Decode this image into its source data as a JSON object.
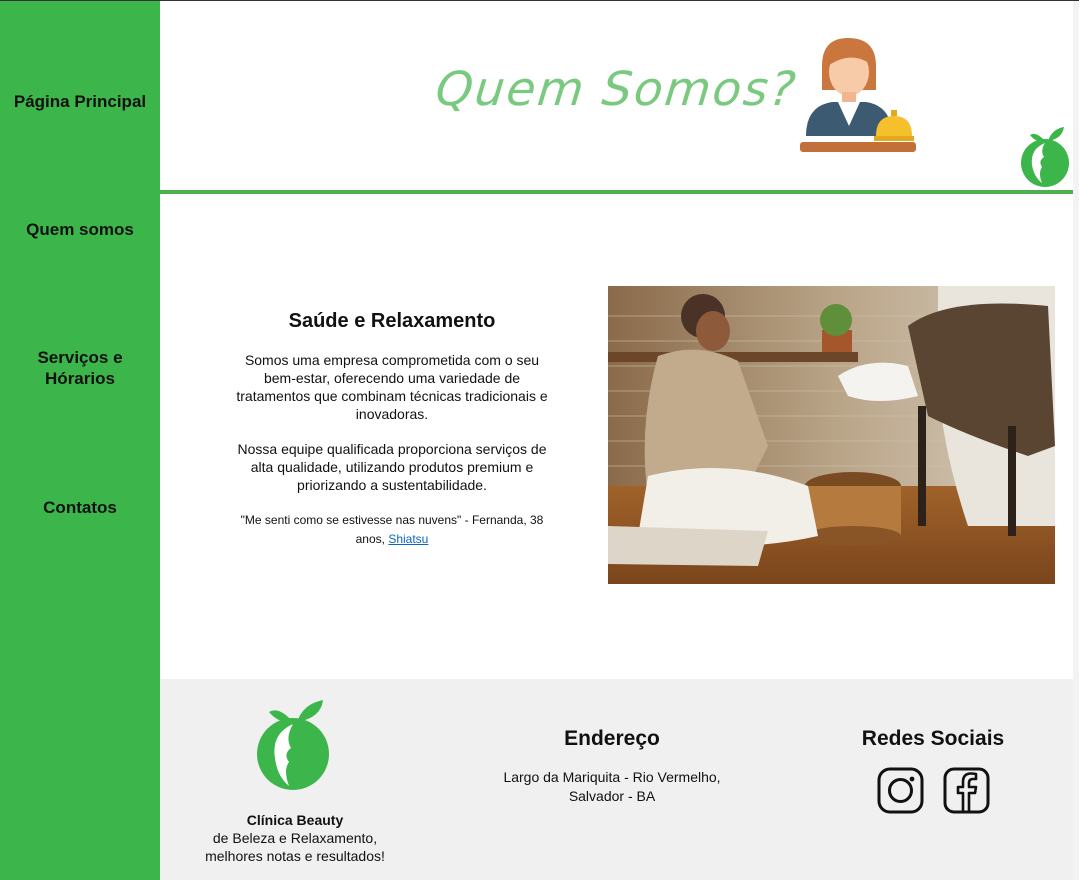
{
  "nav": {
    "items": [
      {
        "label": "Página Principal"
      },
      {
        "label": "Quem somos"
      },
      {
        "label": "Serviços e Hórarios"
      },
      {
        "label": "Contatos"
      }
    ]
  },
  "header": {
    "title": "Quem Somos?",
    "illustration_icon": "receptionist-icon",
    "logo_icon": "leaf-face-logo-icon"
  },
  "main": {
    "section_title": "Saúde e Relaxamento",
    "paragraph1": "Somos uma empresa comprometida com o seu bem-estar, oferecendo uma variedade de tratamentos que combinam técnicas tradicionais e inovadoras.",
    "paragraph2": "Nossa equipe qualificada proporciona serviços de alta qualidade, utilizando produtos premium e priorizando a sustentabilidade.",
    "quote_text": "\"Me senti como se estivesse nas nuvens\" - Fernanda, 38 anos, ",
    "quote_link": "Shiatsu",
    "photo_icon": "spa-foot-bath-photo"
  },
  "footer": {
    "brand_name": "Clínica Beauty",
    "brand_line1": "de Beleza e Relaxamento,",
    "brand_line2": "melhores notas e resultados!",
    "address_title": "Endereço",
    "address_line1": "Largo da Mariquita - Rio Vermelho,",
    "address_line2": "Salvador - BA",
    "social_title": "Redes Sociais",
    "social_icons": [
      "instagram-icon",
      "facebook-icon"
    ]
  },
  "colors": {
    "sidebar": "#3cb54a",
    "title_green": "#79c97f",
    "footer_bg": "#f0f0f0",
    "link": "#0a66c2"
  }
}
